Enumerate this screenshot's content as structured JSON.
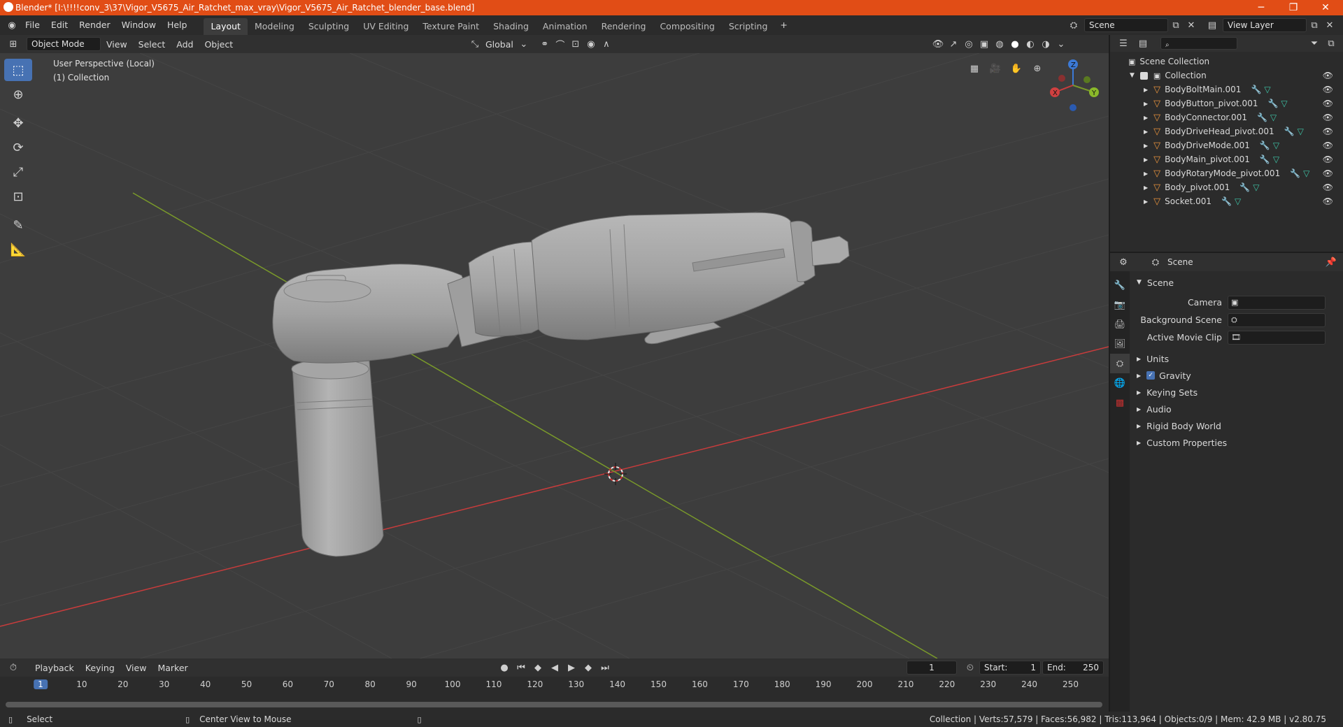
{
  "titlebar": {
    "title": "Blender* [I:\\!!!!conv_3\\37\\Vigor_V5675_Air_Ratchet_max_vray\\Vigor_V5675_Air_Ratchet_blender_base.blend]",
    "minimize": "─",
    "maximize": "❐",
    "close": "✕"
  },
  "menu": {
    "items": [
      "File",
      "Edit",
      "Render",
      "Window",
      "Help"
    ],
    "workspaces": [
      "Layout",
      "Modeling",
      "Sculpting",
      "UV Editing",
      "Texture Paint",
      "Shading",
      "Animation",
      "Rendering",
      "Compositing",
      "Scripting"
    ],
    "add_tab": "+",
    "scene": "Scene",
    "view_layer": "View Layer"
  },
  "viewport_header": {
    "mode": "Object Mode",
    "menus": [
      "View",
      "Select",
      "Add",
      "Object"
    ],
    "orientation": "Global"
  },
  "viewport": {
    "perspective": "User Perspective (Local)",
    "collection": "(1) Collection",
    "gizmo": {
      "x": "X",
      "y": "Y",
      "z": "Z"
    }
  },
  "outliner": {
    "search_placeholder": "",
    "root": "Scene Collection",
    "collection": "Collection",
    "objects": [
      "BodyBoltMain.001",
      "BodyButton_pivot.001",
      "BodyConnector.001",
      "BodyDriveHead_pivot.001",
      "BodyDriveMode.001",
      "BodyMain_pivot.001",
      "BodyRotaryMode_pivot.001",
      "Body_pivot.001",
      "Socket.001"
    ]
  },
  "properties": {
    "context": "Scene",
    "section": "Scene",
    "fields": [
      {
        "label": "Camera",
        "value": ""
      },
      {
        "label": "Background Scene",
        "value": ""
      },
      {
        "label": "Active Movie Clip",
        "value": ""
      }
    ],
    "panels": [
      "Units",
      "Gravity",
      "Keying Sets",
      "Audio",
      "Rigid Body World",
      "Custom Properties"
    ],
    "gravity_checked": true
  },
  "timeline": {
    "menus": [
      "Playback",
      "Keying",
      "View",
      "Marker"
    ],
    "current_frame": "1",
    "start_label": "Start:",
    "start": "1",
    "end_label": "End:",
    "end": "250",
    "ticks": [
      "1",
      "10",
      "20",
      "30",
      "40",
      "50",
      "60",
      "70",
      "80",
      "90",
      "100",
      "110",
      "120",
      "130",
      "140",
      "150",
      "160",
      "170",
      "180",
      "190",
      "200",
      "210",
      "220",
      "230",
      "240",
      "250"
    ]
  },
  "statusbar": {
    "select": "Select",
    "center": "Center View to Mouse",
    "stats": "Collection | Verts:57,579 | Faces:56,982 | Tris:113,964 | Objects:0/9 | Mem: 42.9 MB | v2.80.75"
  },
  "colors": {
    "titlebar": "#e14d16",
    "accent": "#4772b3",
    "x_axis": "#c83c3c",
    "y_axis": "#7a9a2a",
    "z_axis": "#3c7ad6"
  }
}
